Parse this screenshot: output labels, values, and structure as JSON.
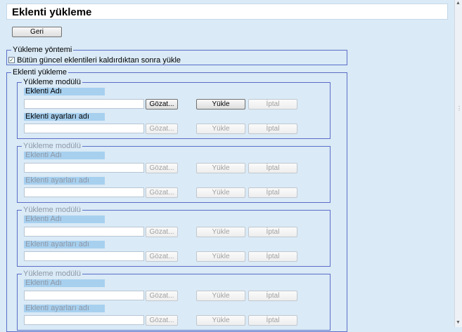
{
  "header": {
    "title": "Eklenti yükleme"
  },
  "toolbar": {
    "back_label": "Geri"
  },
  "install_method": {
    "legend": "Yükleme yöntemi",
    "checkbox_label": "Bütün güncel eklentileri kaldırdıktan sonra yükle",
    "checked": true
  },
  "plugin_install": {
    "legend": "Eklenti yükleme",
    "modules": [
      {
        "legend": "Yükleme modülü",
        "plugin_name_label": "Eklenti Adı",
        "plugin_settings_label": "Eklenti ayarları adı",
        "browse_label": "Gözat...",
        "install_label": "Yükle",
        "cancel_label": "İptal"
      },
      {
        "legend": "Yükleme modülü",
        "plugin_name_label": "Eklenti Adı",
        "plugin_settings_label": "Eklenti ayarları adı",
        "browse_label": "Gözat...",
        "install_label": "Yükle",
        "cancel_label": "İptal"
      },
      {
        "legend": "Yükleme modülü",
        "plugin_name_label": "Eklenti Adı",
        "plugin_settings_label": "Eklenti ayarları adı",
        "browse_label": "Gözat...",
        "install_label": "Yükle",
        "cancel_label": "İptal"
      },
      {
        "legend": "Yükleme modülü",
        "plugin_name_label": "Eklenti Adı",
        "plugin_settings_label": "Eklenti ayarları adı",
        "browse_label": "Gözat...",
        "install_label": "Yükle",
        "cancel_label": "İptal"
      }
    ]
  },
  "icons": {
    "scroll_up": "chevron-up-icon",
    "scroll_down": "chevron-down-icon"
  },
  "colors": {
    "background": "#daeaf6",
    "group_border": "#5a6ec8",
    "label_highlight": "#a7d0ef"
  }
}
